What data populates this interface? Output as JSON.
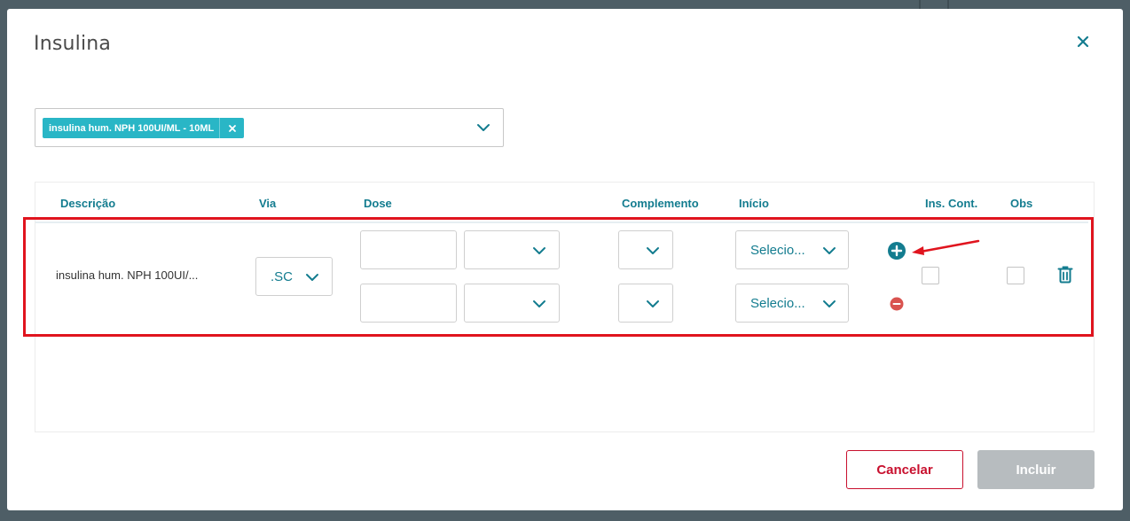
{
  "modal": {
    "title": "Insulina",
    "close_icon": "close-icon"
  },
  "medication_select": {
    "selected_chip": "insulina hum. NPH 100UI/ML - 10ML"
  },
  "table": {
    "headers": [
      "Descrição",
      "Via",
      "Dose",
      "Complemento",
      "Início",
      "Ins. Cont.",
      "Obs"
    ],
    "row": {
      "description": "insulina hum. NPH 100UI/...",
      "via": ".SC",
      "dose_entries": [
        {
          "amount": "",
          "unit": "",
          "complement": "",
          "start": "Selecio..."
        },
        {
          "amount": "",
          "unit": "",
          "complement": "",
          "start": "Selecio..."
        }
      ],
      "ins_cont_checked": false,
      "obs_checked": false
    }
  },
  "footer": {
    "cancel_label": "Cancelar",
    "include_label": "Incluir"
  },
  "colors": {
    "accent": "#137c8f",
    "chip": "#29b6c6",
    "highlight": "#e0141e",
    "danger": "#c8102e",
    "remove": "#d9534f",
    "disabled": "#b7bcbf"
  }
}
